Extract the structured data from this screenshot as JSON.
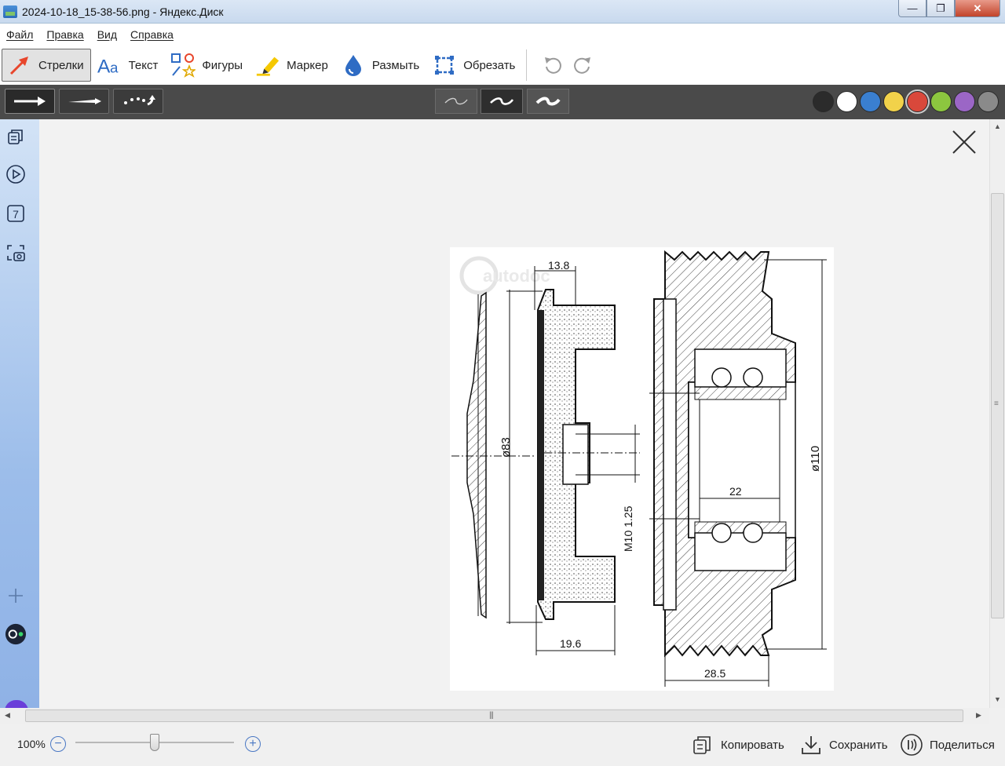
{
  "window": {
    "title": "2024-10-18_15-38-56.png - Яндекс.Диск",
    "minimize": "—",
    "maximize": "❐",
    "close": "✕"
  },
  "menu": [
    "Файл",
    "Правка",
    "Вид",
    "Справка"
  ],
  "tools": [
    {
      "label": "Стрелки",
      "icon": "arrow-icon",
      "active": true
    },
    {
      "label": "Текст",
      "icon": "text-icon",
      "active": false
    },
    {
      "label": "Фигуры",
      "icon": "shapes-icon",
      "active": false
    },
    {
      "label": "Маркер",
      "icon": "marker-icon",
      "active": false
    },
    {
      "label": "Размыть",
      "icon": "blur-drop-icon",
      "active": false
    },
    {
      "label": "Обрезать",
      "icon": "crop-icon",
      "active": false
    }
  ],
  "history": {
    "undo_icon": "undo-icon",
    "redo_icon": "redo-icon"
  },
  "arrow_styles": [
    "straight-arrow",
    "thin-arrow",
    "dotted-arrow"
  ],
  "stroke_widths": [
    "thin",
    "medium",
    "thick"
  ],
  "colors": [
    "#2b2b2b",
    "#ffffff",
    "#3a7fd0",
    "#f2d24a",
    "#d9483b",
    "#8cc63f",
    "#9b66c6",
    "#8a8a8a"
  ],
  "selected_color": "#d9483b",
  "sidebar_icons": [
    "history-icon",
    "play-icon",
    "calendar-icon",
    "screenshot-icon",
    "add-icon",
    "status-icon"
  ],
  "sidebar_calendar_day": "7",
  "drawing": {
    "dims": {
      "d1": "13.8",
      "d2": "ø83",
      "d3": "19.6",
      "d4": "M10 1.25",
      "d5": "22",
      "d6": "ø110",
      "d7": "28.5"
    },
    "watermark": "autodoc"
  },
  "status": {
    "zoom": "100%",
    "zoom_level": 0.5,
    "copy": "Копировать",
    "save": "Сохранить",
    "share": "Поделиться"
  }
}
